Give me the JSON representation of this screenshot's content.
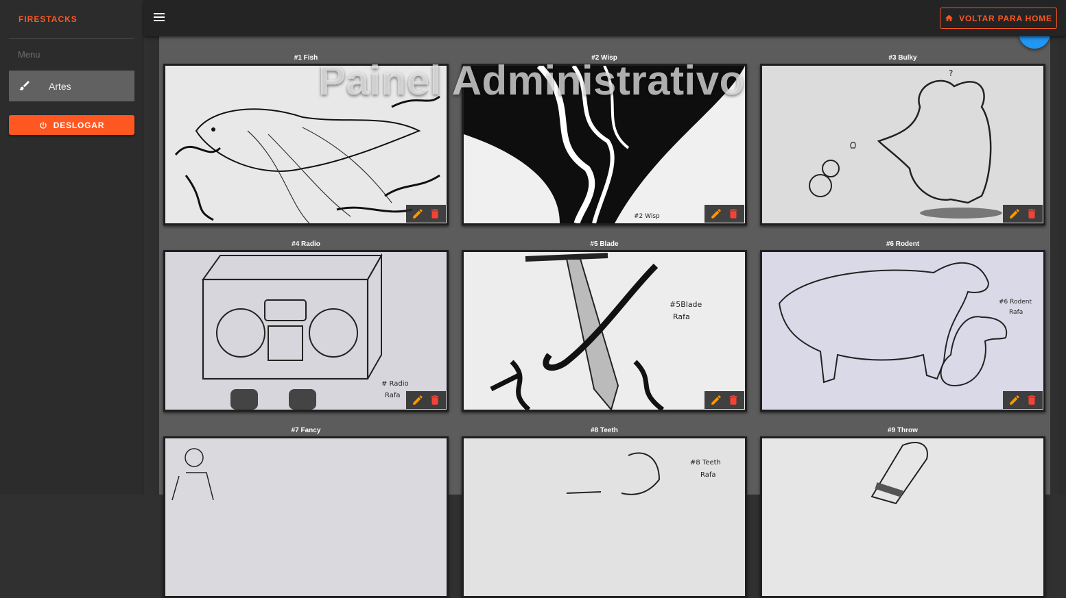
{
  "sidebar": {
    "brand": "FIRESTACKS",
    "menu_label": "Menu",
    "items": [
      {
        "label": "Artes",
        "icon": "brush-icon"
      }
    ],
    "logout_label": "DESLOGAR"
  },
  "topbar": {
    "home_label": "VOLTAR PARA HOME"
  },
  "overlay_title": "Painel Administrativo",
  "artworks": [
    {
      "title": "#1 Fish"
    },
    {
      "title": "#2 Wisp"
    },
    {
      "title": "#3 Bulky"
    },
    {
      "title": "#4 Radio"
    },
    {
      "title": "#5 Blade"
    },
    {
      "title": "#6 Rodent"
    },
    {
      "title": "#7 Fancy"
    },
    {
      "title": "#8 Teeth"
    },
    {
      "title": "#9 Throw"
    }
  ],
  "art_signatures": {
    "wisp": "#2 Wisp",
    "radio": "# Radio",
    "radio_author": "Rafa",
    "blade": "#5Blade",
    "blade_author": "Rafa",
    "rodent": "#6 Rodent",
    "rodent_author": "Rafa",
    "teeth": "#8 Teeth",
    "teeth_author": "Rafa"
  },
  "colors": {
    "accent": "#ff5722",
    "edit": "#ff9800",
    "delete": "#f44336",
    "fab": "#2196f3"
  }
}
